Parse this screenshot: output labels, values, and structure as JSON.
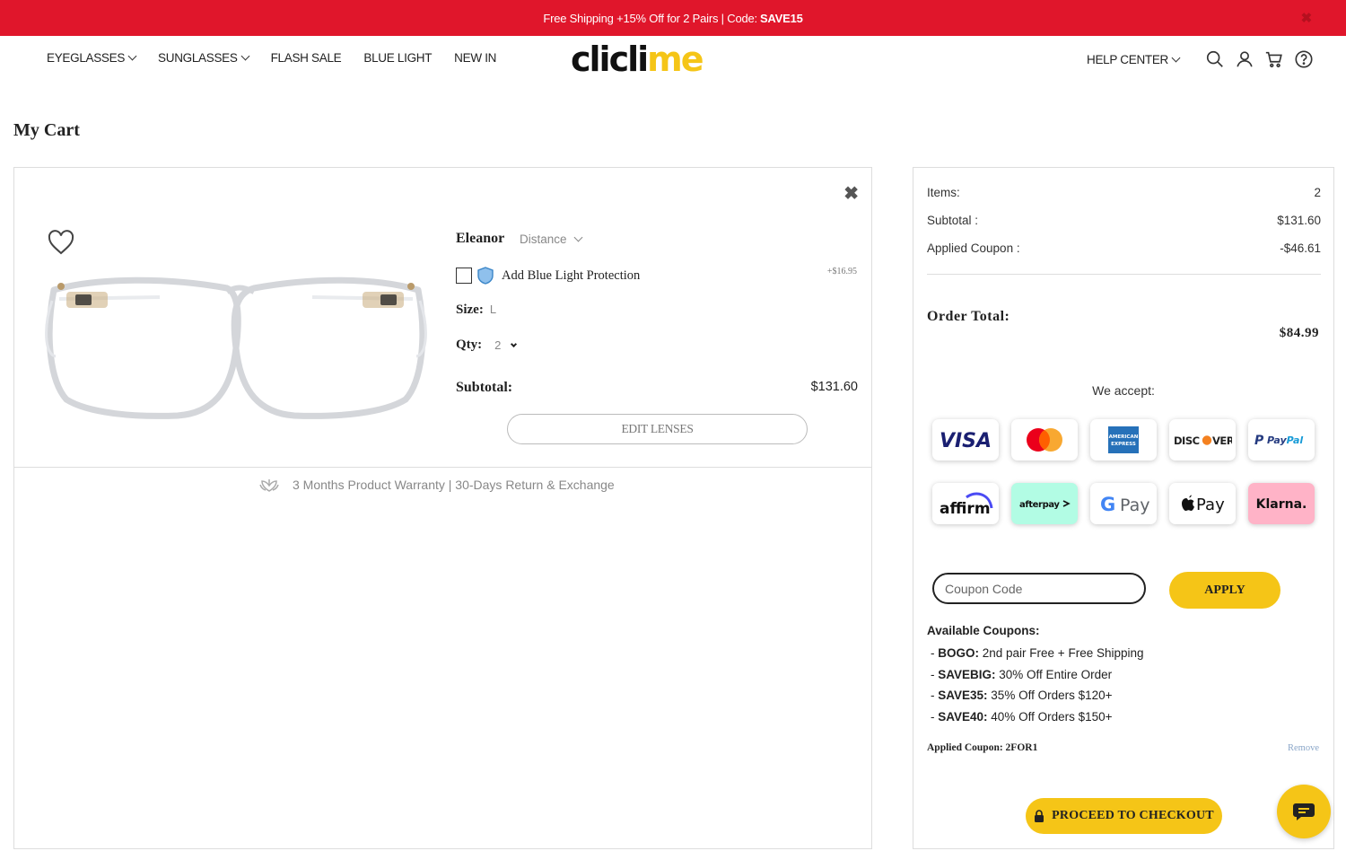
{
  "promo": {
    "text": "Free Shipping +15% Off for 2 Pairs | Code:",
    "code": "SAVE15",
    "close": "✖"
  },
  "nav": {
    "items": [
      {
        "label": "EYEGLASSES",
        "dropdown": true
      },
      {
        "label": "SUNGLASSES",
        "dropdown": true
      },
      {
        "label": "FLASH SALE",
        "dropdown": false
      },
      {
        "label": "BLUE LIGHT",
        "dropdown": false
      },
      {
        "label": "NEW IN",
        "dropdown": false
      }
    ],
    "logo_dark": "clicli",
    "logo_yellow": "me",
    "help_center": "HELP CENTER"
  },
  "page_title": "My Cart",
  "cart_item": {
    "name": "Eleanor",
    "lens_type": "Distance",
    "blue_light_label": "Add Blue Light Protection",
    "blue_light_price": "+$16.95",
    "size_label": "Size:",
    "size_value": "L",
    "qty_label": "Qty:",
    "qty_value": "2",
    "subtotal_label": "Subtotal:",
    "subtotal_value": "$131.60",
    "edit_lenses": "EDIT LENSES",
    "remove": "✖"
  },
  "warranty": "3 Months Product Warranty | 30-Days Return & Exchange",
  "summary": {
    "items_label": "Items:",
    "items_value": "2",
    "subtotal_label": "Subtotal :",
    "subtotal_value": "$131.60",
    "coupon_label": "Applied Coupon :",
    "coupon_value": "-$46.61",
    "order_total_label": "Order Total:",
    "order_total_value": "$84.99",
    "we_accept": "We accept:",
    "payment_methods": [
      "VISA",
      "Mastercard",
      "American Express",
      "DISCOVER",
      "PayPal",
      "affirm",
      "afterpay",
      "G Pay",
      "Apple Pay",
      "Klarna."
    ],
    "coupon_placeholder": "Coupon Code",
    "apply": "APPLY",
    "available_label": "Available Coupons:",
    "coupons": [
      {
        "code": "BOGO:",
        "desc": "2nd pair Free + Free Shipping"
      },
      {
        "code": "SAVEBIG:",
        "desc": "30% Off Entire Order"
      },
      {
        "code": "SAVE35:",
        "desc": "35% Off Orders $120+"
      },
      {
        "code": "SAVE40:",
        "desc": "40% Off Orders $150+"
      }
    ],
    "applied_coupon": "Applied Coupon: 2FOR1",
    "remove": "Remove",
    "checkout": "PROCEED TO CHECKOUT"
  },
  "colors": {
    "promo_red": "#e0162b",
    "accent_yellow": "#f5c517"
  }
}
